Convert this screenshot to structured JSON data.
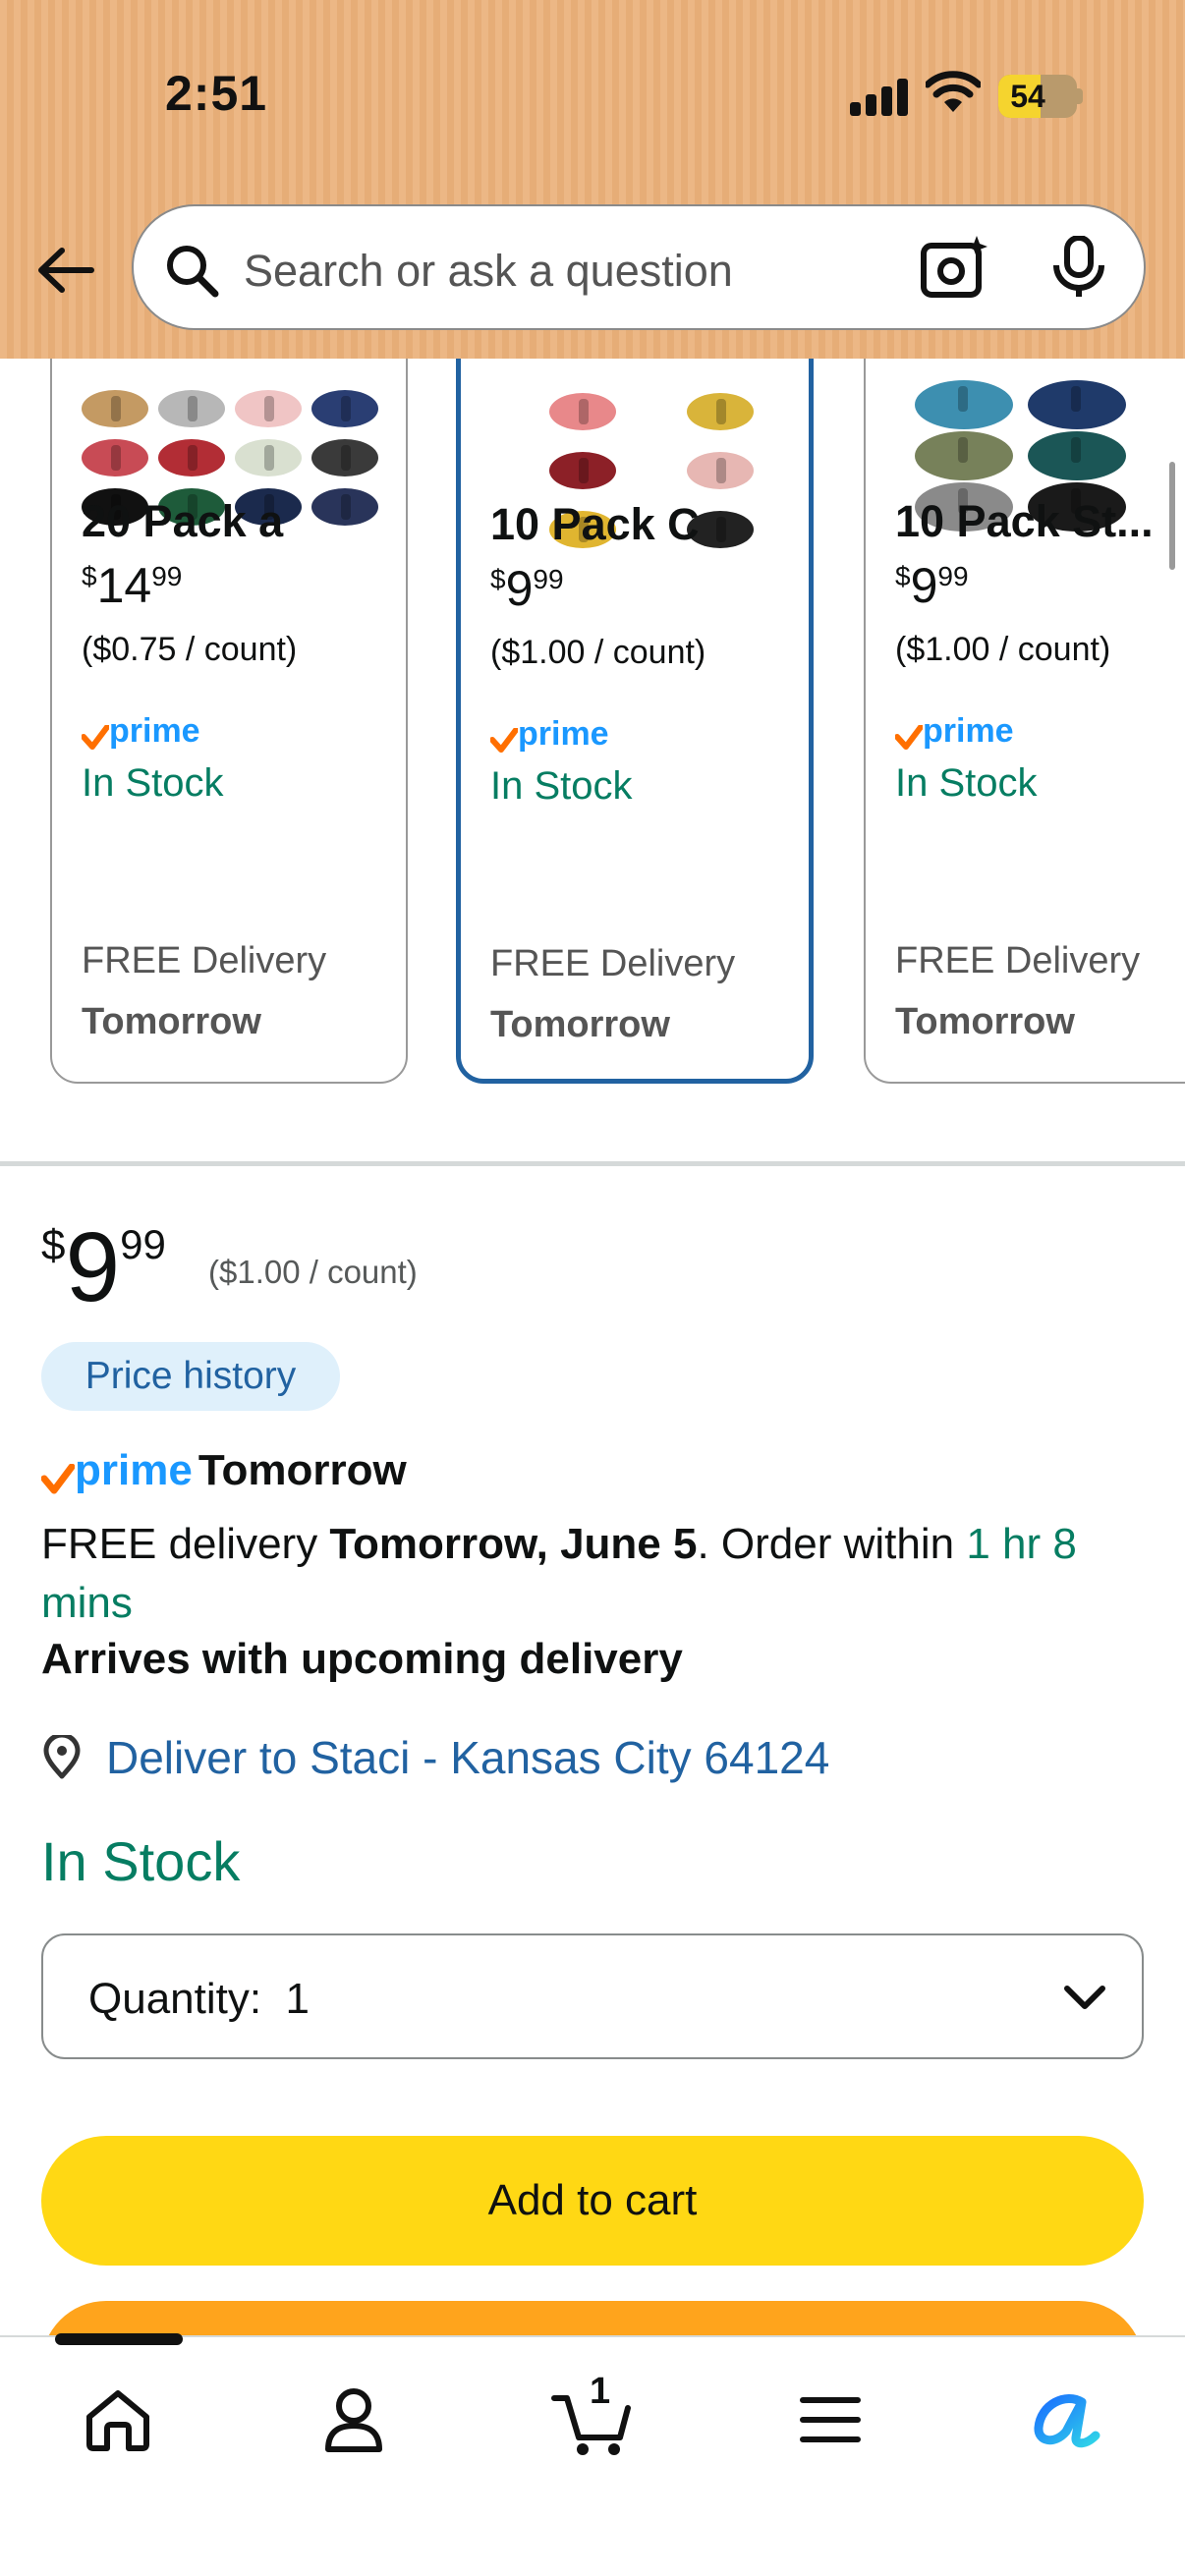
{
  "status_bar": {
    "time": "2:51",
    "battery": "54"
  },
  "search": {
    "placeholder": "Search or ask a question"
  },
  "variants": [
    {
      "name": "20 Pack a",
      "price_dollars": "14",
      "price_cents": "99",
      "unit": "($0.75 / count)",
      "prime": "prime",
      "stock": "In Stock",
      "delivery_line1": "FREE Delivery",
      "delivery_line2": "Tomorrow"
    },
    {
      "name": "10 Pack C",
      "price_dollars": "9",
      "price_cents": "99",
      "unit": "($1.00 / count)",
      "prime": "prime",
      "stock": "In Stock",
      "delivery_line1": "FREE Delivery",
      "delivery_line2": "Tomorrow"
    },
    {
      "name": "10 Pack St...",
      "price_dollars": "9",
      "price_cents": "99",
      "unit": "($1.00 / count)",
      "prime": "prime",
      "stock": "In Stock",
      "delivery_line1": "FREE Delivery",
      "delivery_line2": "Tomorrow"
    }
  ],
  "buybox": {
    "currency": "$",
    "price_dollars": "9",
    "price_cents": "99",
    "unit_price": "($1.00 / count)",
    "price_history": "Price history",
    "prime_word": "prime",
    "prime_day": "Tomorrow",
    "free_delivery_prefix": "FREE delivery",
    "free_delivery_date": "Tomorrow, June 5",
    "order_within": ". Order within",
    "countdown": "1 hr 8 mins",
    "arrives": "Arrives with upcoming delivery",
    "deliver_to": "Deliver to Staci - Kansas City 64124",
    "in_stock": "In Stock",
    "quantity_label": "Quantity:",
    "quantity_value": "1",
    "add_to_cart": "Add to cart"
  },
  "nav": {
    "cart_count": "1"
  },
  "colors": {
    "header": "#ecb785",
    "prime_blue": "#1a98ff",
    "prime_check": "#ff6f00",
    "stock_green": "#067d62",
    "link_blue": "#2162a1",
    "add_to_cart": "#ffd814",
    "buy_now": "#ffa41c"
  }
}
